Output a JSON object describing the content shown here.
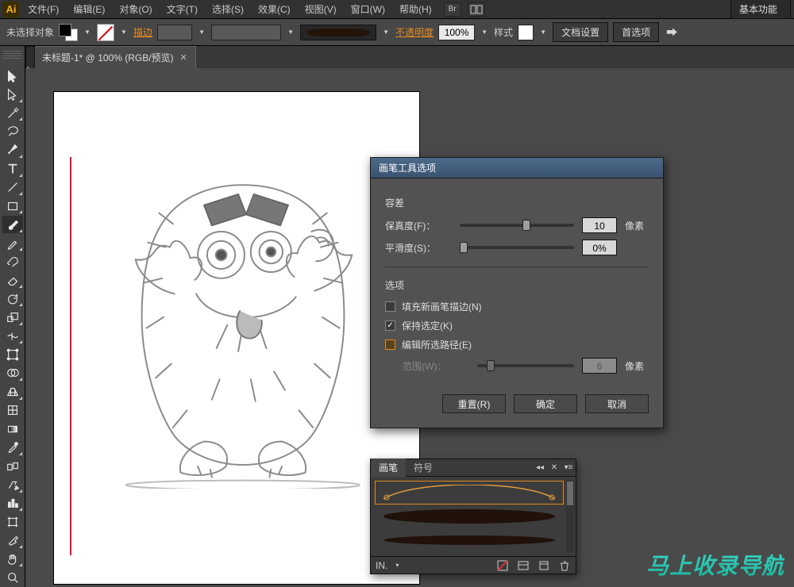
{
  "app": {
    "logo_text": "Ai"
  },
  "workspace_switcher": "基本功能",
  "menus": {
    "file": "文件(F)",
    "edit": "编辑(E)",
    "object": "对象(O)",
    "type": "文字(T)",
    "select": "选择(S)",
    "effect": "效果(C)",
    "view": "视图(V)",
    "window": "窗口(W)",
    "help": "帮助(H)"
  },
  "control": {
    "no_selection": "未选择对象",
    "stroke_label": "描边",
    "stroke_weight": "",
    "opacity_label": "不透明度",
    "opacity_value": "100%",
    "style_label": "样式",
    "doc_setup": "文档设置",
    "prefs": "首选项"
  },
  "tabs": {
    "doc1": "未标题-1* @ 100% (RGB/预览)"
  },
  "dialog": {
    "title": "画笔工具选项",
    "group_tolerance": "容差",
    "fidelity_label": "保真度(F)：",
    "fidelity_value": "10",
    "fidelity_unit": "像素",
    "smoothness_label": "平滑度(S)：",
    "smoothness_value": "0%",
    "group_options": "选项",
    "fill_new": "填充新画笔描边(N)",
    "keep_selected": "保持选定(K)",
    "edit_selected": "编辑所选路径(E)",
    "range_label": "范围(W)：",
    "range_value": "6",
    "range_unit": "像素",
    "reset": "重置(R)",
    "ok": "确定",
    "cancel": "取消"
  },
  "panel": {
    "tab_brushes": "画笔",
    "tab_symbols": "符号",
    "footer_label": "IN."
  },
  "watermark": "马上收录导航"
}
